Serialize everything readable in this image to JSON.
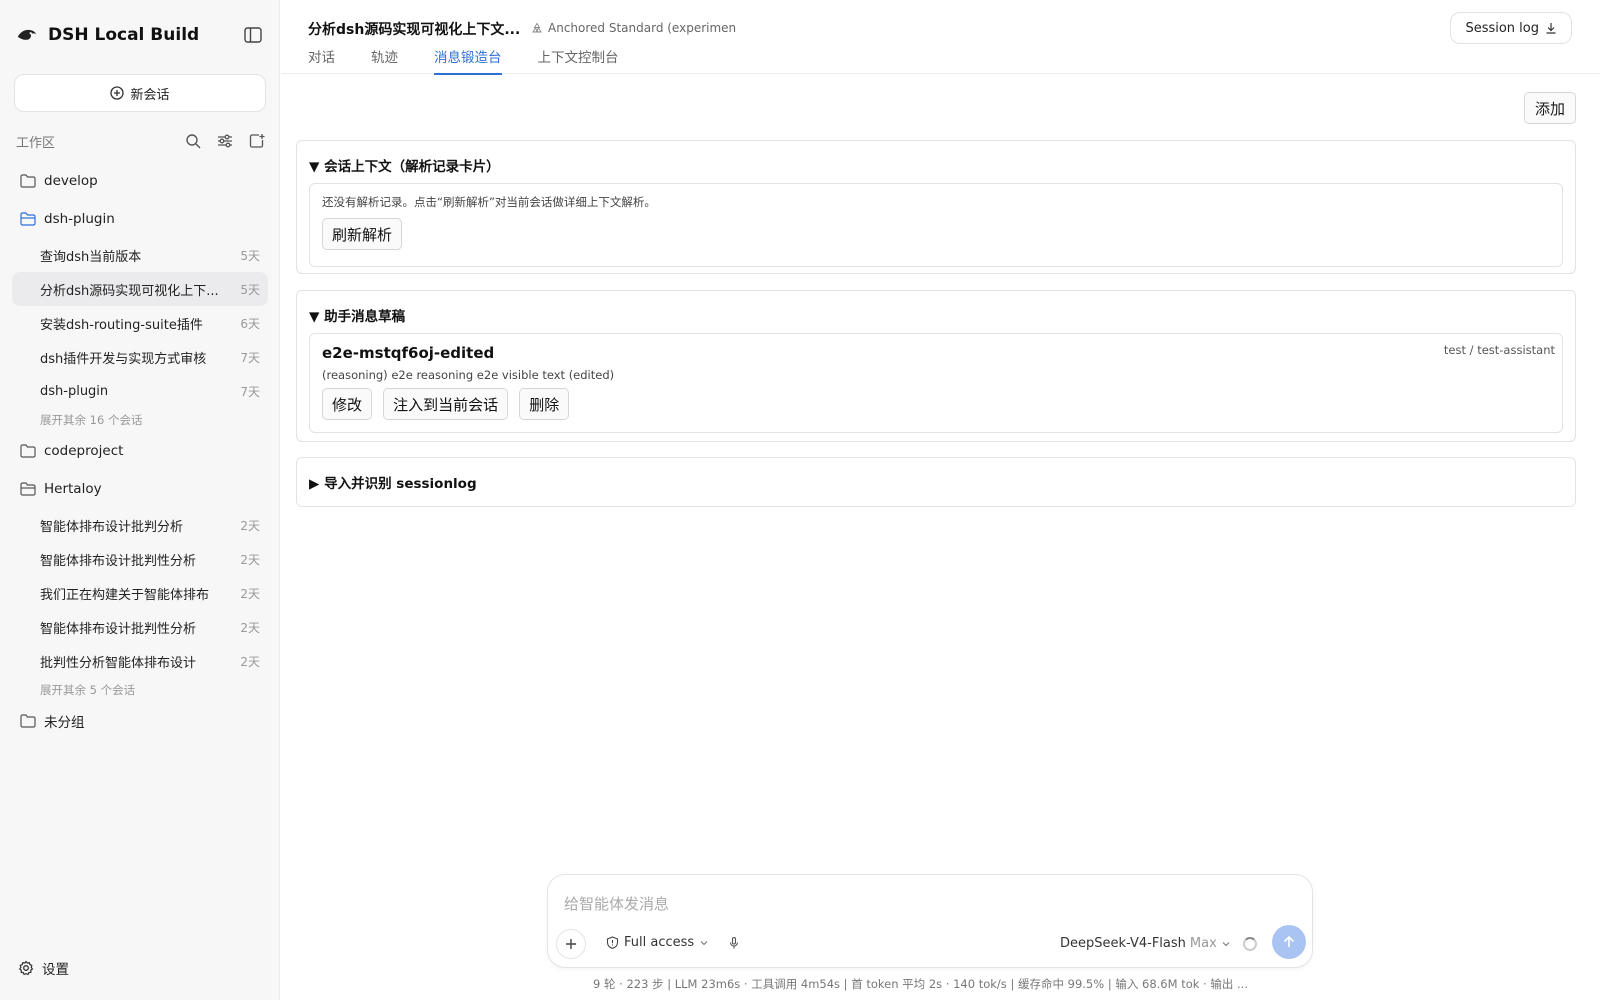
{
  "app": {
    "brand": "DSH Local Build"
  },
  "sidebar": {
    "new_chat_label": "新会话",
    "workspace_label": "工作区",
    "folders": [
      {
        "name": "develop"
      },
      {
        "name": "dsh-plugin",
        "sessions": [
          {
            "title": "查询dsh当前版本",
            "age": "5天"
          },
          {
            "title": "分析dsh源码实现可视化上下...",
            "age": "5天"
          },
          {
            "title": "安装dsh-routing-suite插件",
            "age": "6天"
          },
          {
            "title": "dsh插件开发与实现方式审核",
            "age": "7天"
          },
          {
            "title": "dsh-plugin",
            "age": "7天"
          }
        ],
        "expand_more": "展开其余 16 个会话"
      },
      {
        "name": "codeproject"
      },
      {
        "name": "Hertaloy",
        "sessions": [
          {
            "title": "智能体排布设计批判分析",
            "age": "2天"
          },
          {
            "title": "智能体排布设计批判性分析",
            "age": "2天"
          },
          {
            "title": "我们正在构建关于智能体排布",
            "age": "2天"
          },
          {
            "title": "智能体排布设计批判性分析",
            "age": "2天"
          },
          {
            "title": "批判性分析智能体排布设计",
            "age": "2天"
          }
        ],
        "expand_more": "展开其余 5 个会话"
      },
      {
        "name": "未分组"
      }
    ],
    "settings_label": "设置"
  },
  "header": {
    "title": "分析dsh源码实现可视化上下文...",
    "model_chip": "Anchored Standard (experimen",
    "tabs": [
      "对话",
      "轨迹",
      "消息锻造台",
      "上下文控制台"
    ],
    "active_tab": "消息锻造台",
    "session_log_label": "Session log"
  },
  "main": {
    "add_label": "添加",
    "context_panel": {
      "heading": "▼ 会话上下文（解析记录卡片）",
      "hint": "还没有解析记录。点击“刷新解析”对当前会话做详细上下文解析。",
      "refresh_label": "刷新解析"
    },
    "draft_panel": {
      "heading": "▼ 助手消息草稿",
      "draft_title": "e2e-mstqf6oj-edited",
      "draft_meta": "test / test-assistant",
      "draft_text": "(reasoning) e2e reasoning e2e visible text (edited)",
      "edit_label": "修改",
      "inject_label": "注入到当前会话",
      "delete_label": "删除"
    },
    "import_panel": {
      "heading": "▶ 导入并识别 sessionlog"
    }
  },
  "composer": {
    "placeholder": "给智能体发消息",
    "access_label": "Full access",
    "model_name": "DeepSeek-V4-Flash",
    "effort": "Max"
  },
  "statusbar": {
    "text": "9 轮 · 223 步   |   LLM 23m6s · 工具调用 4m54s   |   首 token 平均 2s · 140 tok/s   |   缓存命中 99.5%   |   输入 68.6M tok · 输出 ..."
  },
  "colors": {
    "accent": "#2f6fd6",
    "send_button": "#a9c4f3",
    "sidebar_bg": "#f7f7f8"
  }
}
